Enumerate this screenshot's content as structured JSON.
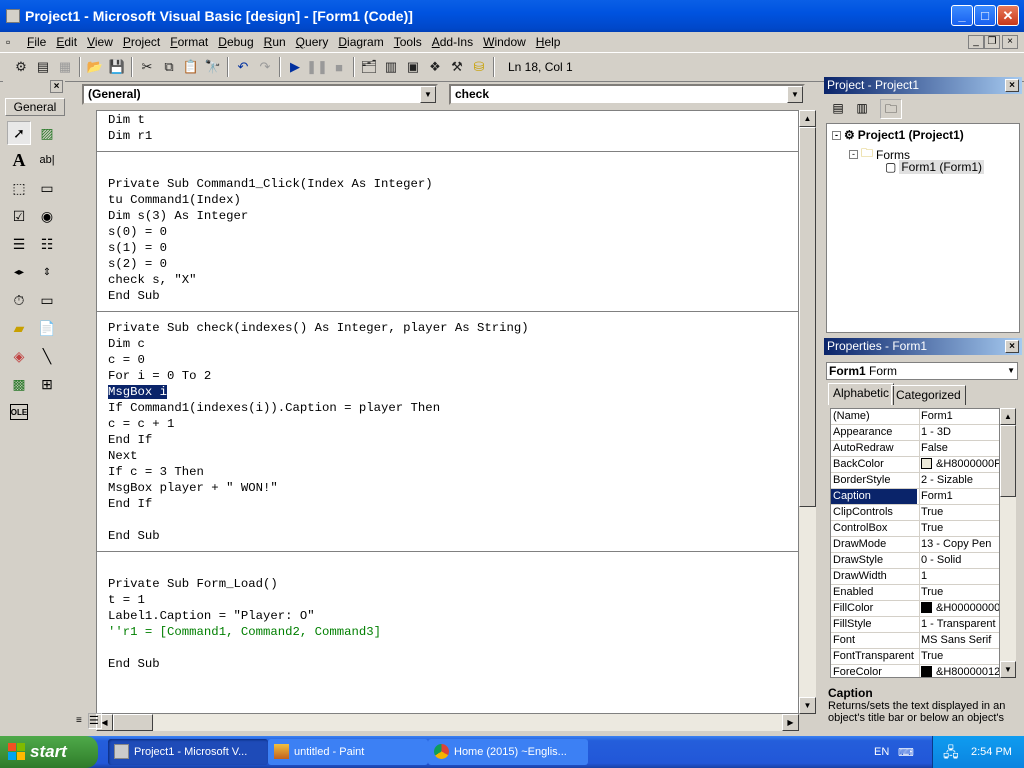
{
  "window": {
    "title": "Project1 - Microsoft Visual Basic [design] - [Form1 (Code)]"
  },
  "menu": [
    "File",
    "Edit",
    "View",
    "Project",
    "Format",
    "Debug",
    "Run",
    "Query",
    "Diagram",
    "Tools",
    "Add-Ins",
    "Window",
    "Help"
  ],
  "toolbar": {
    "status": "Ln 18, Col 1"
  },
  "toolbox": {
    "tab_label": "General"
  },
  "code": {
    "object_combo": "(General)",
    "proc_combo": "check",
    "lines": [
      "Dim t",
      "Dim r1",
      "",
      "",
      "Private Sub Command1_Click(Index As Integer)",
      "tu Command1(Index)",
      "Dim s(3) As Integer",
      "s(0) = 0",
      "s(1) = 0",
      "s(2) = 0",
      "check s, \"X\"",
      "End Sub",
      "",
      "Private Sub check(indexes() As Integer, player As String)",
      "Dim c",
      "c = 0",
      "For i = 0 To 2",
      "MsgBox i",
      "If Command1(indexes(i)).Caption = player Then",
      "c = c + 1",
      "End If",
      "Next",
      "If c = 3 Then",
      "MsgBox player + \" WON!\"",
      "End If",
      "",
      "End Sub",
      "",
      "",
      "Private Sub Form_Load()",
      "t = 1",
      "Label1.Caption = \"Player: O\"",
      "''r1 = [Command1, Command2, Command3]",
      "",
      "End Sub"
    ]
  },
  "project": {
    "title": "Project - Project1",
    "root": "Project1 (Project1)",
    "folder": "Forms",
    "form": "Form1 (Form1)"
  },
  "properties": {
    "title": "Properties - Form1",
    "object_name": "Form1",
    "object_type": "Form",
    "tab_alpha": "Alphabetic",
    "tab_cat": "Categorized",
    "rows": [
      {
        "name": "(Name)",
        "value": "Form1"
      },
      {
        "name": "Appearance",
        "value": "1 - 3D"
      },
      {
        "name": "AutoRedraw",
        "value": "False"
      },
      {
        "name": "BackColor",
        "value": "&H8000000F&",
        "swatch": "#ece9d8"
      },
      {
        "name": "BorderStyle",
        "value": "2 - Sizable"
      },
      {
        "name": "Caption",
        "value": "Form1"
      },
      {
        "name": "ClipControls",
        "value": "True"
      },
      {
        "name": "ControlBox",
        "value": "True"
      },
      {
        "name": "DrawMode",
        "value": "13 - Copy Pen"
      },
      {
        "name": "DrawStyle",
        "value": "0 - Solid"
      },
      {
        "name": "DrawWidth",
        "value": "1"
      },
      {
        "name": "Enabled",
        "value": "True"
      },
      {
        "name": "FillColor",
        "value": "&H00000000&",
        "swatch": "#000000"
      },
      {
        "name": "FillStyle",
        "value": "1 - Transparent"
      },
      {
        "name": "Font",
        "value": "MS Sans Serif"
      },
      {
        "name": "FontTransparent",
        "value": "True"
      },
      {
        "name": "ForeColor",
        "value": "&H80000012&",
        "swatch": "#000000"
      }
    ],
    "desc_title": "Caption",
    "desc_text": "Returns/sets the text displayed in an object's title bar or below an object's"
  },
  "taskbar": {
    "start": "start",
    "tasks": [
      "Project1 - Microsoft V...",
      "untitled - Paint",
      "Home (2015) ~Englis..."
    ],
    "lang": "EN",
    "clock": "2:54 PM"
  }
}
